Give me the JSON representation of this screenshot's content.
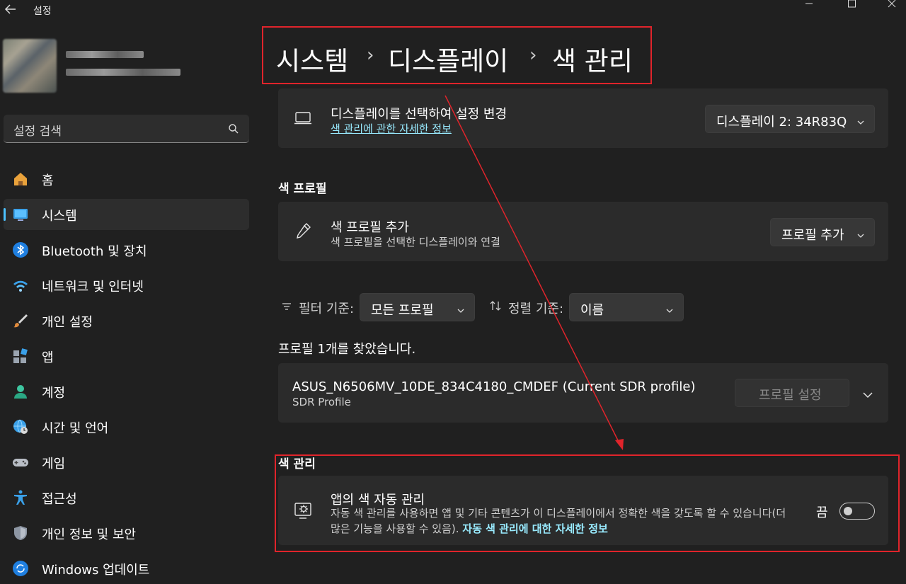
{
  "window": {
    "title": "설정",
    "back_icon": "back-arrow-icon",
    "controls": [
      "minimize",
      "maximize",
      "close"
    ]
  },
  "search": {
    "placeholder": "설정 검색",
    "icon": "search-icon"
  },
  "nav": [
    {
      "label": "홈",
      "icon": "home-icon"
    },
    {
      "label": "시스템",
      "icon": "system-icon",
      "active": true
    },
    {
      "label": "Bluetooth 및 장치",
      "icon": "bluetooth-icon"
    },
    {
      "label": "네트워크 및 인터넷",
      "icon": "wifi-icon"
    },
    {
      "label": "개인 설정",
      "icon": "brush-icon"
    },
    {
      "label": "앱",
      "icon": "apps-icon"
    },
    {
      "label": "계정",
      "icon": "account-icon"
    },
    {
      "label": "시간 및 언어",
      "icon": "globe-clock-icon"
    },
    {
      "label": "게임",
      "icon": "gamepad-icon"
    },
    {
      "label": "접근성",
      "icon": "accessibility-icon"
    },
    {
      "label": "개인 정보 및 보안",
      "icon": "shield-icon"
    },
    {
      "label": "Windows 업데이트",
      "icon": "update-icon"
    }
  ],
  "breadcrumb": {
    "level1": "시스템",
    "level2": "디스플레이",
    "level3": "색 관리",
    "separator": "›"
  },
  "display_select": {
    "title": "디스플레이를 선택하여 설정 변경",
    "link": "색 관리에 관한 자세한 정보",
    "dropdown_value": "디스플레이 2: 34R83Q"
  },
  "color_profiles": {
    "heading": "색 프로필",
    "add_title": "색 프로필 추가",
    "add_subtitle": "색 프로필을 선택한 디스플레이와 연결",
    "add_button": "프로필 추가"
  },
  "filters": {
    "filter_label": "필터 기준:",
    "filter_value": "모든 프로필",
    "sort_label": "정렬 기준:",
    "sort_value": "이름"
  },
  "results": {
    "count_text": "프로필 1개를 찾았습니다.",
    "profile_name": "ASUS_N6506MV_10DE_834C4180_CMDEF (Current SDR profile)",
    "profile_type": "SDR Profile",
    "set_profile_button": "프로필 설정"
  },
  "color_management": {
    "heading": "색 관리",
    "title": "앱의 색 자동 관리",
    "description": "자동 색 관리를 사용하면 앱 및 기타 콘텐츠가 이 디스플레이에서 정확한 색을 갖도록 할 수 있습니다(더 많은 기능을 사용할 수 있음).",
    "link": "자동 색 관리에 대한 자세한 정보",
    "toggle_state_label": "끔",
    "toggle_on": false
  },
  "colors": {
    "accent": "#4cc2ff",
    "link": "#99ebff",
    "annotation": "#e0242b",
    "background": "#202020",
    "card": "#2b2b2b"
  }
}
